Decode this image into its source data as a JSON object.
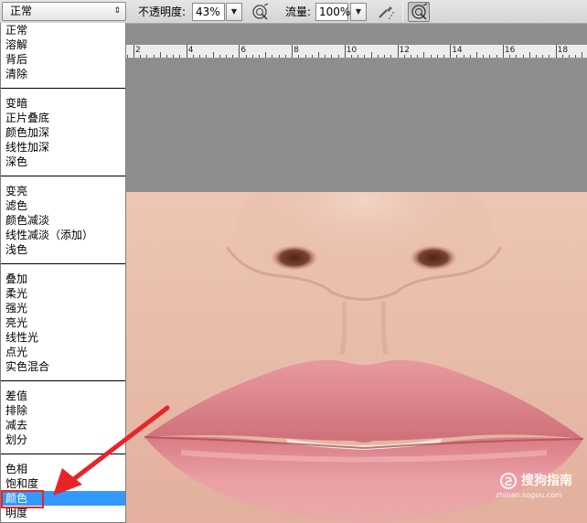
{
  "options_bar": {
    "mode_value": "正常",
    "opacity_label": "不透明度:",
    "opacity_value": "43%",
    "flow_label": "流量:",
    "flow_value": "100%"
  },
  "ruler": {
    "numbers": [
      "2",
      "4",
      "6",
      "8",
      "10",
      "12",
      "14",
      "16",
      "18"
    ]
  },
  "blend_menu": {
    "groups": [
      [
        "正常",
        "溶解",
        "背后",
        "清除"
      ],
      [
        "变暗",
        "正片叠底",
        "颜色加深",
        "线性加深",
        "深色"
      ],
      [
        "变亮",
        "滤色",
        "颜色减淡",
        "线性减淡（添加）",
        "浅色"
      ],
      [
        "叠加",
        "柔光",
        "强光",
        "亮光",
        "线性光",
        "点光",
        "实色混合"
      ],
      [
        "差值",
        "排除",
        "减去",
        "划分"
      ],
      [
        "色相",
        "饱和度",
        "颜色",
        "明度"
      ]
    ],
    "selected": "颜色"
  },
  "watermark": {
    "text": "搜狗指南",
    "url": "zhinan.sogou.com"
  },
  "colors": {
    "selection": "#3399ff",
    "annotation": "#e8242a"
  }
}
